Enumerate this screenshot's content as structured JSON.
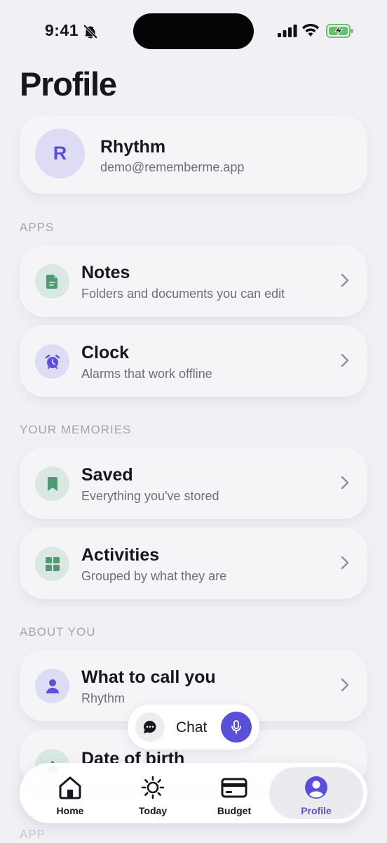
{
  "status": {
    "time": "9:41"
  },
  "page": {
    "title": "Profile"
  },
  "profile": {
    "initial": "R",
    "name": "Rhythm",
    "email": "demo@rememberme.app"
  },
  "sections": {
    "apps": "APPS",
    "memories": "YOUR MEMORIES",
    "about": "ABOUT YOU",
    "app": "APP"
  },
  "items": {
    "notes": {
      "title": "Notes",
      "subtitle": "Folders and documents you can edit",
      "icon": "document-icon"
    },
    "clock": {
      "title": "Clock",
      "subtitle": "Alarms that work offline",
      "icon": "alarm-clock-icon"
    },
    "saved": {
      "title": "Saved",
      "subtitle": "Everything you've stored",
      "icon": "bookmark-icon"
    },
    "activities": {
      "title": "Activities",
      "subtitle": "Grouped by what they are",
      "icon": "grid-icon"
    },
    "name": {
      "title": "What to call you",
      "subtitle": "Rhythm",
      "icon": "person-icon"
    },
    "dob": {
      "title": "Date of birth",
      "icon": "cake-icon"
    }
  },
  "chat": {
    "label": "Chat"
  },
  "tabs": [
    {
      "label": "Home",
      "icon": "home-icon"
    },
    {
      "label": "Today",
      "icon": "sun-icon"
    },
    {
      "label": "Budget",
      "icon": "card-icon"
    },
    {
      "label": "Profile",
      "icon": "profile-icon",
      "active": true
    }
  ],
  "colors": {
    "accent": "#5a4fd8",
    "green": "#4f9a74",
    "background": "#f1f1f5"
  }
}
